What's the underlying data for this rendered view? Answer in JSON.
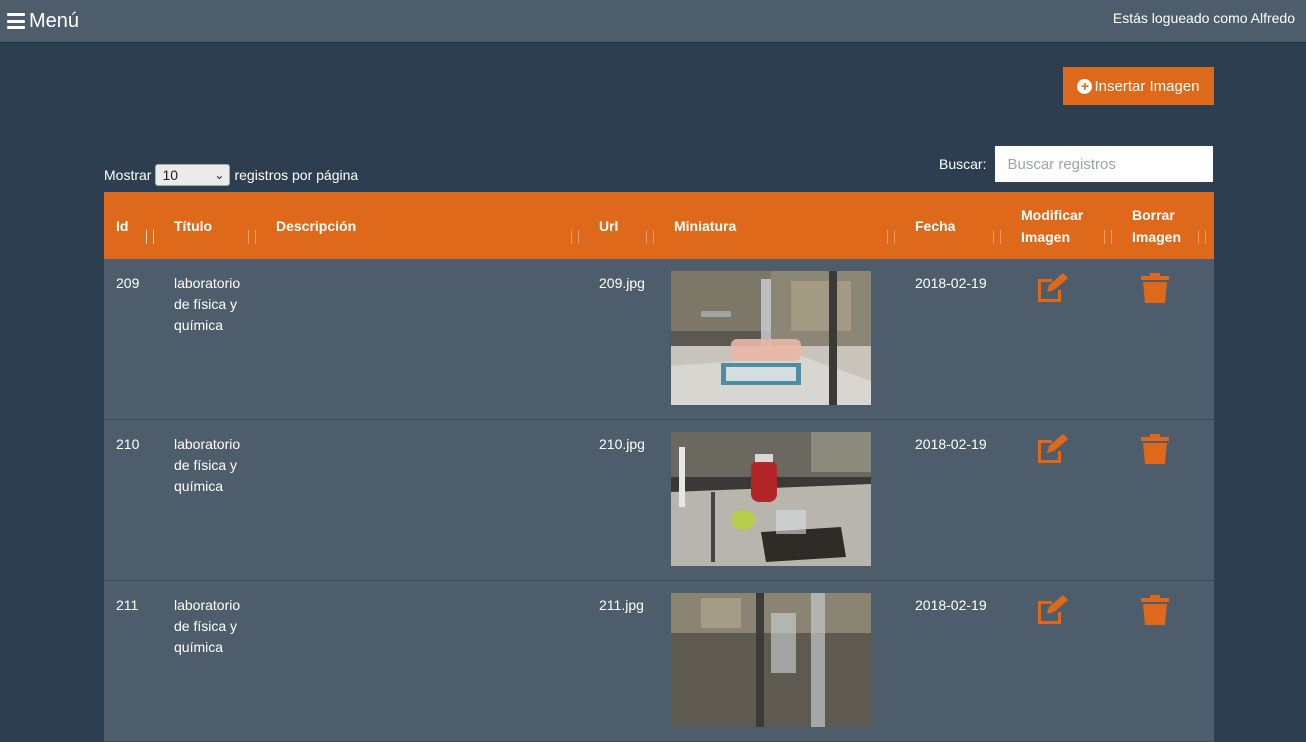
{
  "topbar": {
    "menu_label": "Menú",
    "logged_text": "Estás logueado como Alfredo"
  },
  "toolbar": {
    "insert_label": "Insertar Imagen"
  },
  "length": {
    "prefix": "Mostrar",
    "selected": "10",
    "suffix": "registros por página"
  },
  "search": {
    "label": "Buscar:",
    "placeholder": "Buscar registros"
  },
  "table": {
    "headers": {
      "id": "Id",
      "title": "Título",
      "description": "Descripción",
      "url": "Url",
      "thumbnail": "Miniatura",
      "date": "Fecha",
      "modify_line1": "Modificar",
      "modify_line2": "Imagen",
      "delete_line1": "Borrar",
      "delete_line2": "Imagen"
    },
    "rows": [
      {
        "id": "209",
        "title": "laboratorio de física y química",
        "description": "",
        "url": "209.jpg",
        "date": "2018-02-19"
      },
      {
        "id": "210",
        "title": "laboratorio de física y química",
        "description": "",
        "url": "210.jpg",
        "date": "2018-02-19"
      },
      {
        "id": "211",
        "title": "laboratorio de física y química",
        "description": "",
        "url": "211.jpg",
        "date": "2018-02-19"
      }
    ]
  },
  "colors": {
    "accent": "#df691a",
    "topbar": "#4e5d6c",
    "background": "#2c3e50",
    "row": "#4e5d6c"
  },
  "icons": {
    "menu": "hamburger-icon",
    "insert": "plus-circle-icon",
    "modify": "edit-icon",
    "delete": "trash-icon"
  }
}
